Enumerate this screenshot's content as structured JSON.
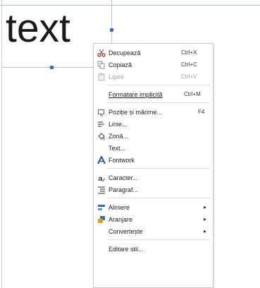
{
  "canvas": {
    "text": "text"
  },
  "context_menu": {
    "items": [
      {
        "label": "Decupează",
        "shortcut": "Ctrl+X",
        "icon": "cut-icon",
        "enabled": true
      },
      {
        "label": "Copiază",
        "shortcut": "Ctrl+C",
        "icon": "copy-icon",
        "enabled": true
      },
      {
        "label": "Lipire",
        "shortcut": "Ctrl+V",
        "icon": "paste-icon",
        "enabled": false
      },
      {
        "label": "Formatare implicită",
        "shortcut": "Ctrl+M",
        "icon": "",
        "enabled": true
      },
      {
        "label": "Poziție și mărime...",
        "shortcut": "F4",
        "icon": "position-size-icon",
        "enabled": true
      },
      {
        "label": "Linie...",
        "shortcut": "",
        "icon": "line-icon",
        "enabled": true
      },
      {
        "label": "Zonă...",
        "shortcut": "",
        "icon": "area-fill-icon",
        "enabled": true
      },
      {
        "label": "Text...",
        "shortcut": "",
        "icon": "",
        "enabled": true
      },
      {
        "label": "Fontwork",
        "shortcut": "",
        "icon": "fontwork-icon",
        "enabled": true
      },
      {
        "label": "Caracter...",
        "shortcut": "",
        "icon": "character-icon",
        "enabled": true
      },
      {
        "label": "Paragraf...",
        "shortcut": "",
        "icon": "paragraph-icon",
        "enabled": true
      },
      {
        "label": "Aliniere",
        "shortcut": "",
        "icon": "align-icon",
        "enabled": true,
        "submenu": true
      },
      {
        "label": "Aranjare",
        "shortcut": "",
        "icon": "arrange-icon",
        "enabled": true,
        "submenu": true
      },
      {
        "label": "Convertește",
        "shortcut": "",
        "icon": "",
        "enabled": true,
        "submenu": true
      },
      {
        "label": "Editare stil...",
        "shortcut": "",
        "icon": "",
        "enabled": true
      }
    ],
    "submenu_arrow": "▸"
  }
}
